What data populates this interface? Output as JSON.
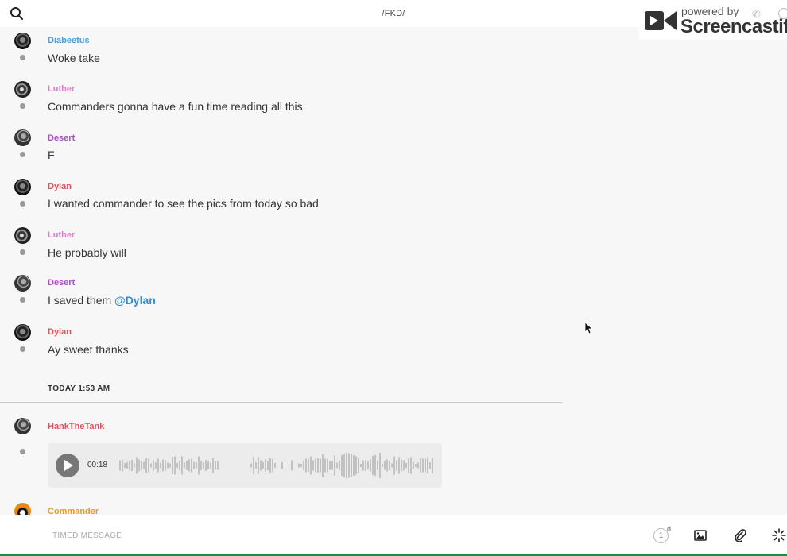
{
  "header": {
    "title": "/FKD/"
  },
  "watermark": {
    "small_text": "powered by",
    "big_text": "Screencastify"
  },
  "messages": [
    {
      "sender": "Diabeetus",
      "text": "Woke take",
      "color": "#4a9fd8"
    },
    {
      "sender": "Luther",
      "text": "Commanders gonna have a fun time reading all this",
      "color": "#e37bc8"
    },
    {
      "sender": "Desert",
      "text": "F",
      "color": "#b04fc9"
    },
    {
      "sender": "Dylan",
      "text": "I wanted commander to see the pics from today so bad",
      "color": "#e0525a"
    },
    {
      "sender": "Luther",
      "text": "He probably will",
      "color": "#e37bc8"
    },
    {
      "sender": "Desert",
      "text_prefix": "I saved them ",
      "mention": "@Dylan",
      "color": "#b04fc9"
    },
    {
      "sender": "Dylan",
      "text": "Ay sweet thanks",
      "color": "#e0525a"
    }
  ],
  "day_divider": {
    "label": "TODAY 1:53 AM"
  },
  "voice_message": {
    "sender": "HankTheTank",
    "duration": "00:18",
    "color": "#e0525a"
  },
  "next_message": {
    "sender": "Commander",
    "color": "#e99a33"
  },
  "composer": {
    "placeholder": "TIMED MESSAGE",
    "timer_value": "1",
    "timer_unit": "d"
  },
  "icons": {
    "search": "search-icon",
    "play": "play-icon",
    "timer": "timer-icon",
    "image": "image-icon",
    "attach": "paperclip-icon",
    "effects": "sparkle-icon"
  }
}
